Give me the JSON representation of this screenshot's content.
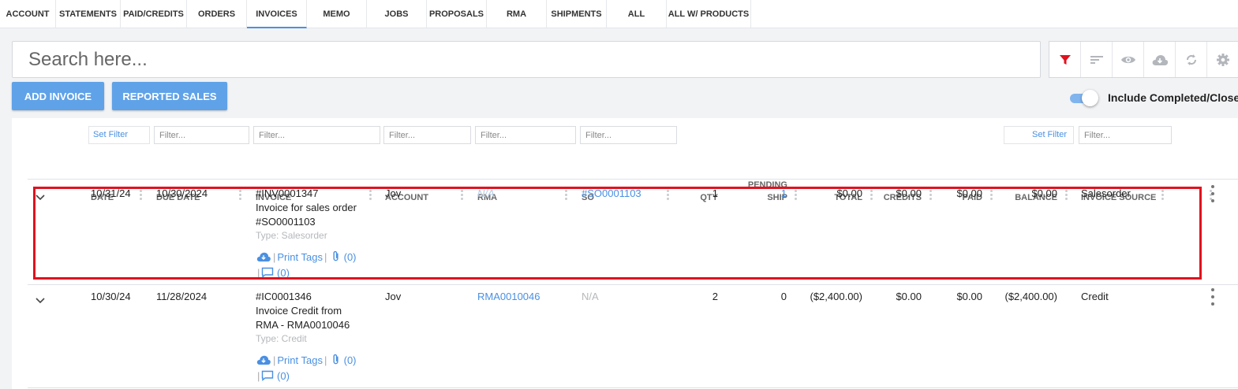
{
  "tabs": [
    "ACCOUNT",
    "STATEMENTS",
    "PAID/CREDITS",
    "ORDERS",
    "INVOICES",
    "MEMO",
    "JOBS",
    "PROPOSALS",
    "RMA",
    "SHIPMENTS",
    "ALL",
    "ALL W/ PRODUCTS"
  ],
  "active_tab": "INVOICES",
  "search": {
    "placeholder": "Search here..."
  },
  "toolbar_icons": [
    "filter-icon",
    "sort-icon",
    "eye-icon",
    "cloud-download-icon",
    "sync-icon",
    "gear-icon"
  ],
  "colors": {
    "accent": "#4a90e2",
    "button": "#5fa2e8",
    "filter_active": "#e0121e",
    "highlight": "#e0121e"
  },
  "buttons": {
    "add_invoice": "ADD INVOICE",
    "reported_sales": "REPORTED SALES"
  },
  "toggle": {
    "label": "Include Completed/Closed",
    "on": true
  },
  "filters": {
    "set_filter": "Set Filter",
    "placeholder": "Filter..."
  },
  "columns": {
    "date": "DATE",
    "due_date": "DUE DATE",
    "invoice": "INVOICE",
    "account": "ACCOUNT",
    "rma": "RMA",
    "so": "SO",
    "qty": "QTY",
    "pending_ship_1": "PENDING",
    "pending_ship_2": "SHIP",
    "total": "TOTAL",
    "credits": "CREDITS",
    "paid": "PAID",
    "balance": "BALANCE",
    "invoice_source": "INVOICE SOURCE"
  },
  "rows": [
    {
      "date": "10/31/24",
      "due_date": "10/30/2024",
      "invoice_no": "#INV0001347",
      "desc_1": "Invoice for sales order",
      "desc_2": "#SO0001103",
      "type": "Type: Salesorder",
      "account": "Jov",
      "rma": "N/A",
      "so": "#SO0001103",
      "qty": "1",
      "pending_ship": "1",
      "total": "$0.00",
      "credits": "$0.00",
      "paid": "$0.00",
      "balance": "$0.00",
      "source": "Salesorder",
      "print_tags": "Print Tags",
      "attach_count": "(0)",
      "comment_count": "(0)"
    },
    {
      "date": "10/30/24",
      "due_date": "11/28/2024",
      "invoice_no": "#IC0001346",
      "desc_1": "Invoice Credit from",
      "desc_2": "RMA - RMA0010046",
      "type": "Type: Credit",
      "account": "Jov",
      "rma": "RMA0010046",
      "so": "N/A",
      "qty": "2",
      "pending_ship": "0",
      "total": "($2,400.00)",
      "credits": "$0.00",
      "paid": "$0.00",
      "balance": "($2,400.00)",
      "source": "Credit",
      "print_tags": "Print Tags",
      "attach_count": "(0)",
      "comment_count": "(0)"
    }
  ]
}
